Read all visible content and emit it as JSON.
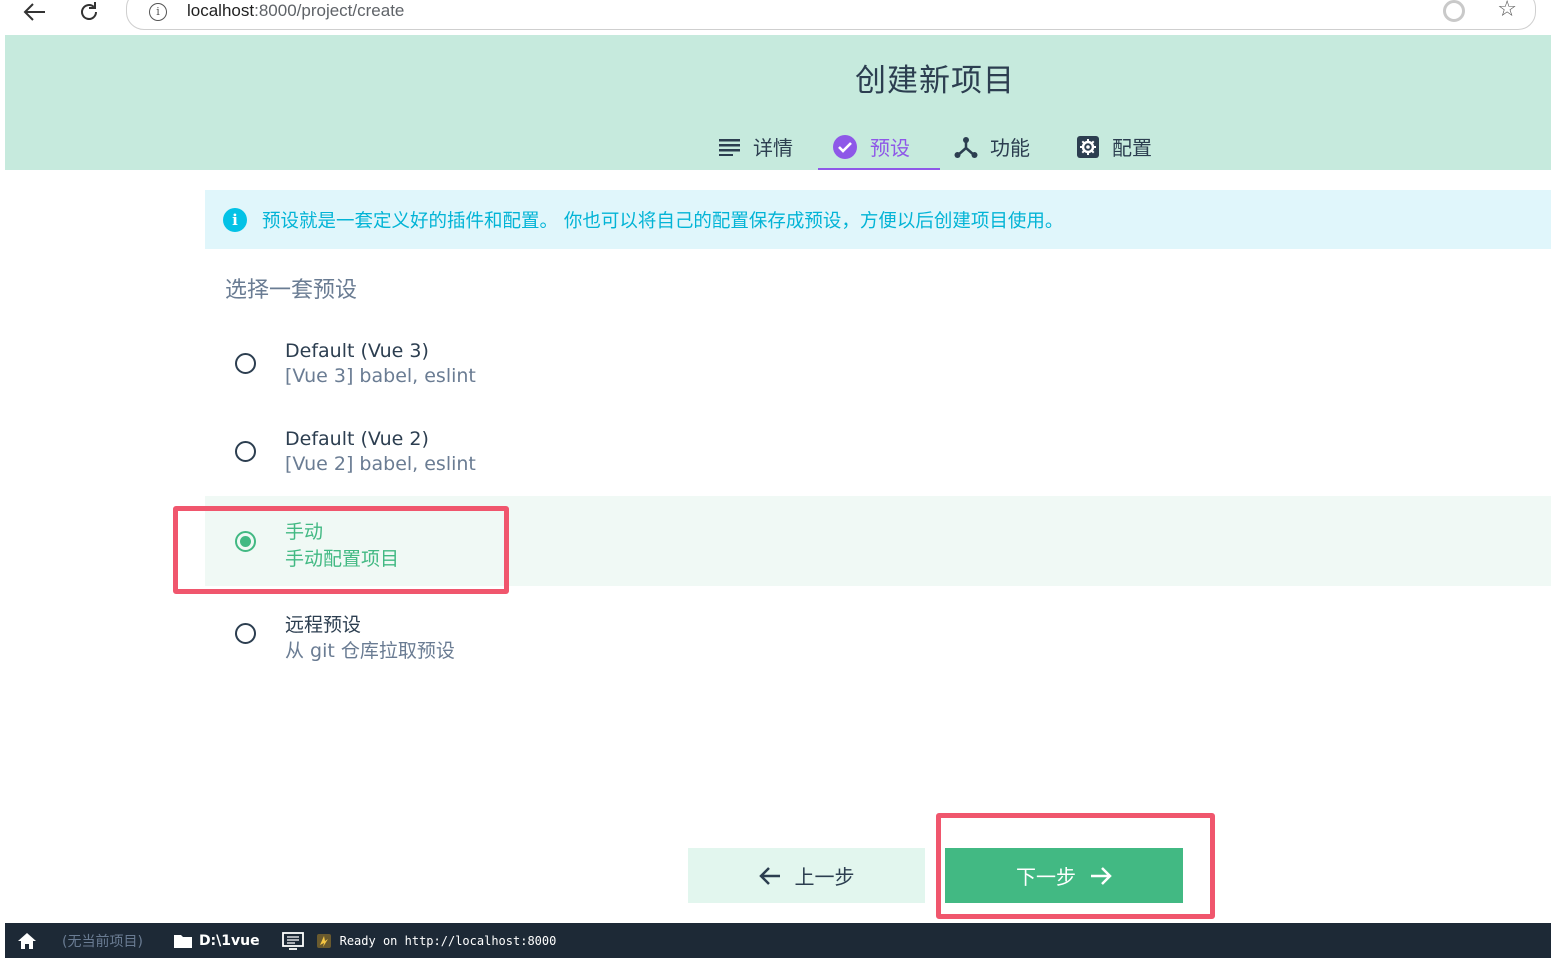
{
  "browser": {
    "url_host": "localhost",
    "url_path": ":8000/project/create",
    "back_icon": "arrow-left-icon",
    "reload_icon": "reload-icon"
  },
  "header": {
    "title": "创建新项目",
    "tabs": [
      {
        "label": "详情",
        "icon": "list-icon",
        "active": false
      },
      {
        "label": "预设",
        "icon": "check-circle-icon",
        "active": true
      },
      {
        "label": "功能",
        "icon": "fork-icon",
        "active": false
      },
      {
        "label": "配置",
        "icon": "gear-icon",
        "active": false
      }
    ]
  },
  "banner": {
    "text": "预设就是一套定义好的插件和配置。 你也可以将自己的配置保存成预设，方便以后创建项目使用。"
  },
  "section_title": "选择一套预设",
  "presets": [
    {
      "name": "Default (Vue 3)",
      "desc": "[Vue 3] babel, eslint",
      "selected": false
    },
    {
      "name": "Default (Vue 2)",
      "desc": "[Vue 2] babel, eslint",
      "selected": false
    },
    {
      "name": "手动",
      "desc": "手动配置项目",
      "selected": true
    },
    {
      "name": "远程预设",
      "desc": "从 git 仓库拉取预设",
      "selected": false
    }
  ],
  "footer": {
    "prev_label": "上一步",
    "next_label": "下一步"
  },
  "statusbar": {
    "project": "(无当前项目)",
    "folder": "D:\\1vue",
    "log": "Ready on http://localhost:8000"
  },
  "colors": {
    "accent": "#42b983",
    "active_tab": "#8e58e8",
    "header_bg": "#c6eadd",
    "banner_text": "#03b4d6",
    "highlight": "#f0566d",
    "statusbar_bg": "#1d2936"
  }
}
